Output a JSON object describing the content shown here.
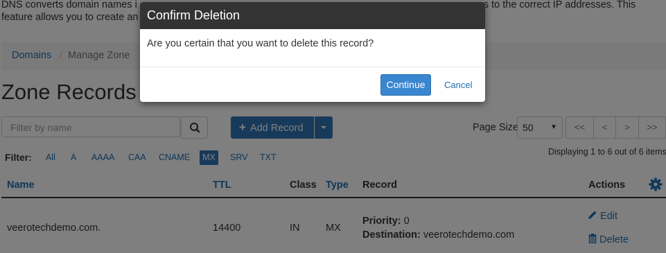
{
  "intro": {
    "line1_start": "DNS converts domain names i",
    "line1_end": "s to the correct IP addresses. This",
    "line2_start": "feature allows you to create an"
  },
  "breadcrumb": {
    "domains": "Domains",
    "separator": "/",
    "current": "Manage Zone"
  },
  "page": {
    "title": "Zone Records"
  },
  "search": {
    "placeholder": "Filter by name"
  },
  "toolbar": {
    "add_record": "Add Record"
  },
  "paging": {
    "page_size_label": "Page Size",
    "page_size_value": "50",
    "first": "<<",
    "prev": "<",
    "next": ">",
    "last": ">>",
    "displaying": "Displaying 1 to 6 out of 6 items"
  },
  "filter": {
    "label": "Filter:",
    "options": [
      "All",
      "A",
      "AAAA",
      "CAA",
      "CNAME",
      "MX",
      "SRV",
      "TXT"
    ],
    "active": "MX"
  },
  "table": {
    "headers": {
      "name": "Name",
      "ttl": "TTL",
      "class": "Class",
      "type": "Type",
      "record": "Record",
      "actions": "Actions"
    },
    "rows": [
      {
        "name": "veerotechdemo.com.",
        "ttl": "14400",
        "class": "IN",
        "type": "MX",
        "priority_label": "Priority:",
        "priority_value": "0",
        "destination_label": "Destination:",
        "destination_value": "veerotechdemo.com",
        "edit": "Edit",
        "delete": "Delete"
      }
    ]
  },
  "modal": {
    "title": "Confirm Deletion",
    "message": "Are you certain that you want to delete this record?",
    "continue": "Continue",
    "cancel": "Cancel"
  },
  "colors": {
    "accent": "#2f74b5",
    "link": "#1f6fb5",
    "modal_header": "#333333"
  }
}
